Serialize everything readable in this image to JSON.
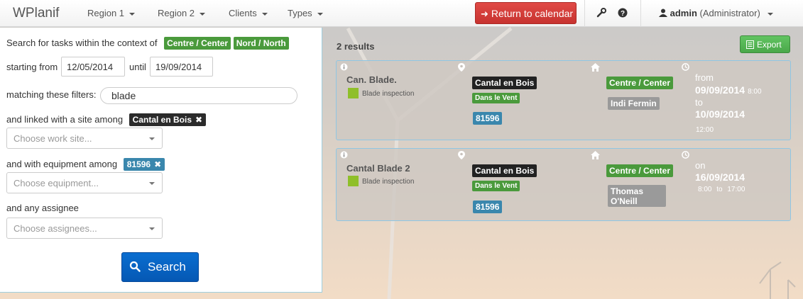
{
  "navbar": {
    "brand": "WPlanif",
    "menus": [
      "Region 1",
      "Region 2",
      "Clients",
      "Types"
    ],
    "return_button": "Return to calendar",
    "user_name": "admin",
    "user_role": "(Administrator)"
  },
  "search": {
    "context_prefix": "Search for tasks within the context of",
    "context_tags": [
      "Centre / Center",
      "Nord / North"
    ],
    "starting_label": "starting from",
    "start_date": "12/05/2014",
    "until_label": "until",
    "end_date": "19/09/2014",
    "filters_label": "matching these filters:",
    "filters_value": "blade",
    "site_label": "and linked with a site among",
    "site_chip": "Cantal en Bois",
    "site_placeholder": "Choose work site...",
    "equipment_label": "and with equipment among",
    "equipment_chip": "81596",
    "equipment_placeholder": "Choose equipment...",
    "assignee_label": "and any assignee",
    "assignee_placeholder": "Choose assignees...",
    "search_button": "Search"
  },
  "results": {
    "count_label": "2 results",
    "export_button": "Export",
    "items": [
      {
        "title": "Can. Blade.",
        "type": "Blade inspection",
        "site": "Cantal en Bois",
        "subsite": "Dans le Vent",
        "equipment": "81596",
        "context": "Centre / Center",
        "assignee": "Indi Fermin",
        "from_label": "from",
        "from_date": "09/09/2014",
        "from_time": "8:00",
        "to_label": "to",
        "to_date": "10/09/2014",
        "to_time": "12:00"
      },
      {
        "title": "Cantal Blade 2",
        "type": "Blade inspection",
        "site": "Cantal en Bois",
        "subsite": "Dans le Vent",
        "equipment": "81596",
        "context": "Centre / Center",
        "assignee_line1": "Thomas",
        "assignee_line2": "O'Neill",
        "on_label": "on",
        "date": "16/09/2014",
        "start_time": "8:00",
        "to_word": "to",
        "end_time": "17:00"
      }
    ]
  },
  "colors": {
    "green_label": "#4a9a3c",
    "blue_label": "#3a87ad",
    "danger": "#d9534f",
    "primary": "#0a6ed0",
    "type_square": "#8fbf2a"
  }
}
